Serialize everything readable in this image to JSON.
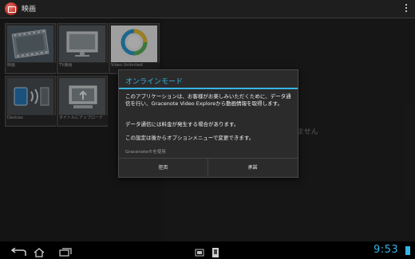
{
  "app": {
    "title": "映画",
    "icon": "film-reel-icon"
  },
  "tiles": [
    {
      "label": "映画",
      "icon": "film-strip-icon"
    },
    {
      "label": "TV番組",
      "icon": "tv-icon"
    },
    {
      "label": "Video Unlimited",
      "icon": "video-unlimited-icon"
    },
    {
      "label": "Devices",
      "icon": "devices-icon"
    },
    {
      "label": "タイトルにアップロード",
      "icon": "upload-to-tv-icon"
    }
  ],
  "background_message": "ません",
  "dialog": {
    "title": "オンラインモード",
    "paragraph1": "このアプリケーションは、お客様がお楽しみいただくために、データ通信を行い、Gracenote Video Exploreから動画情報を取得します。",
    "paragraph2": "データ通信には料金が発生する場合があります。",
    "paragraph3": "この設定は後からオプションメニューで変更できます。",
    "gracenote_label": "Gracenote®を使用",
    "decline_label": "拒否",
    "accept_label": "承諾"
  },
  "system_bar": {
    "clock": "9:53",
    "accent": "#35b5e5"
  },
  "colors": {
    "accent": "#35b5e5",
    "app_icon": "#c2382e"
  }
}
